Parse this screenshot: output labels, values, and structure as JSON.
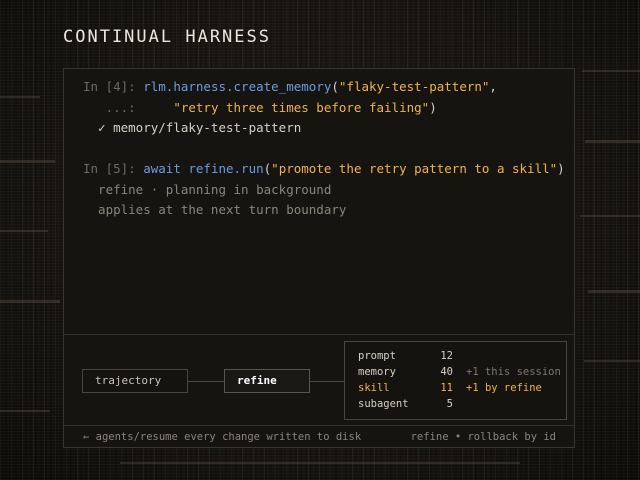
{
  "title": "CONTINUAL HARNESS",
  "terminal": {
    "cell4": {
      "prompt": "In [4]: ",
      "call": "rlm.harness.create_memory",
      "open": "(",
      "arg1": "\"flaky-test-pattern\"",
      "comma": ",",
      "cont_prompt": "   ...:     ",
      "arg2": "\"retry three times before failing\"",
      "close": ")",
      "result_mark": "  ✓",
      "result_text": " memory/flaky-test-pattern"
    },
    "cell5": {
      "prompt": "In [5]: ",
      "await_call": "await refine.run",
      "open": "(",
      "arg": "\"promote the retry pattern to a skill\"",
      "close": ")",
      "out1": "  refine · planning in background",
      "out2": "  applies at the next turn boundary"
    }
  },
  "pipeline": {
    "node1": "trajectory",
    "node2": "refine"
  },
  "stats": [
    {
      "name": "prompt",
      "value": "12",
      "note": ""
    },
    {
      "name": "memory",
      "value": "40",
      "note": "+1 this session"
    },
    {
      "name": "skill",
      "value": "11",
      "note": "+1 by refine",
      "highlight": true
    },
    {
      "name": "subagent",
      "value": "5",
      "note": ""
    }
  ],
  "footer": {
    "left": "← agents/resume every change written to disk",
    "right": "refine • rollback by id"
  },
  "colors": {
    "accent": "#f0b34a",
    "function": "#6c9ce0",
    "background": "#1b1814"
  }
}
